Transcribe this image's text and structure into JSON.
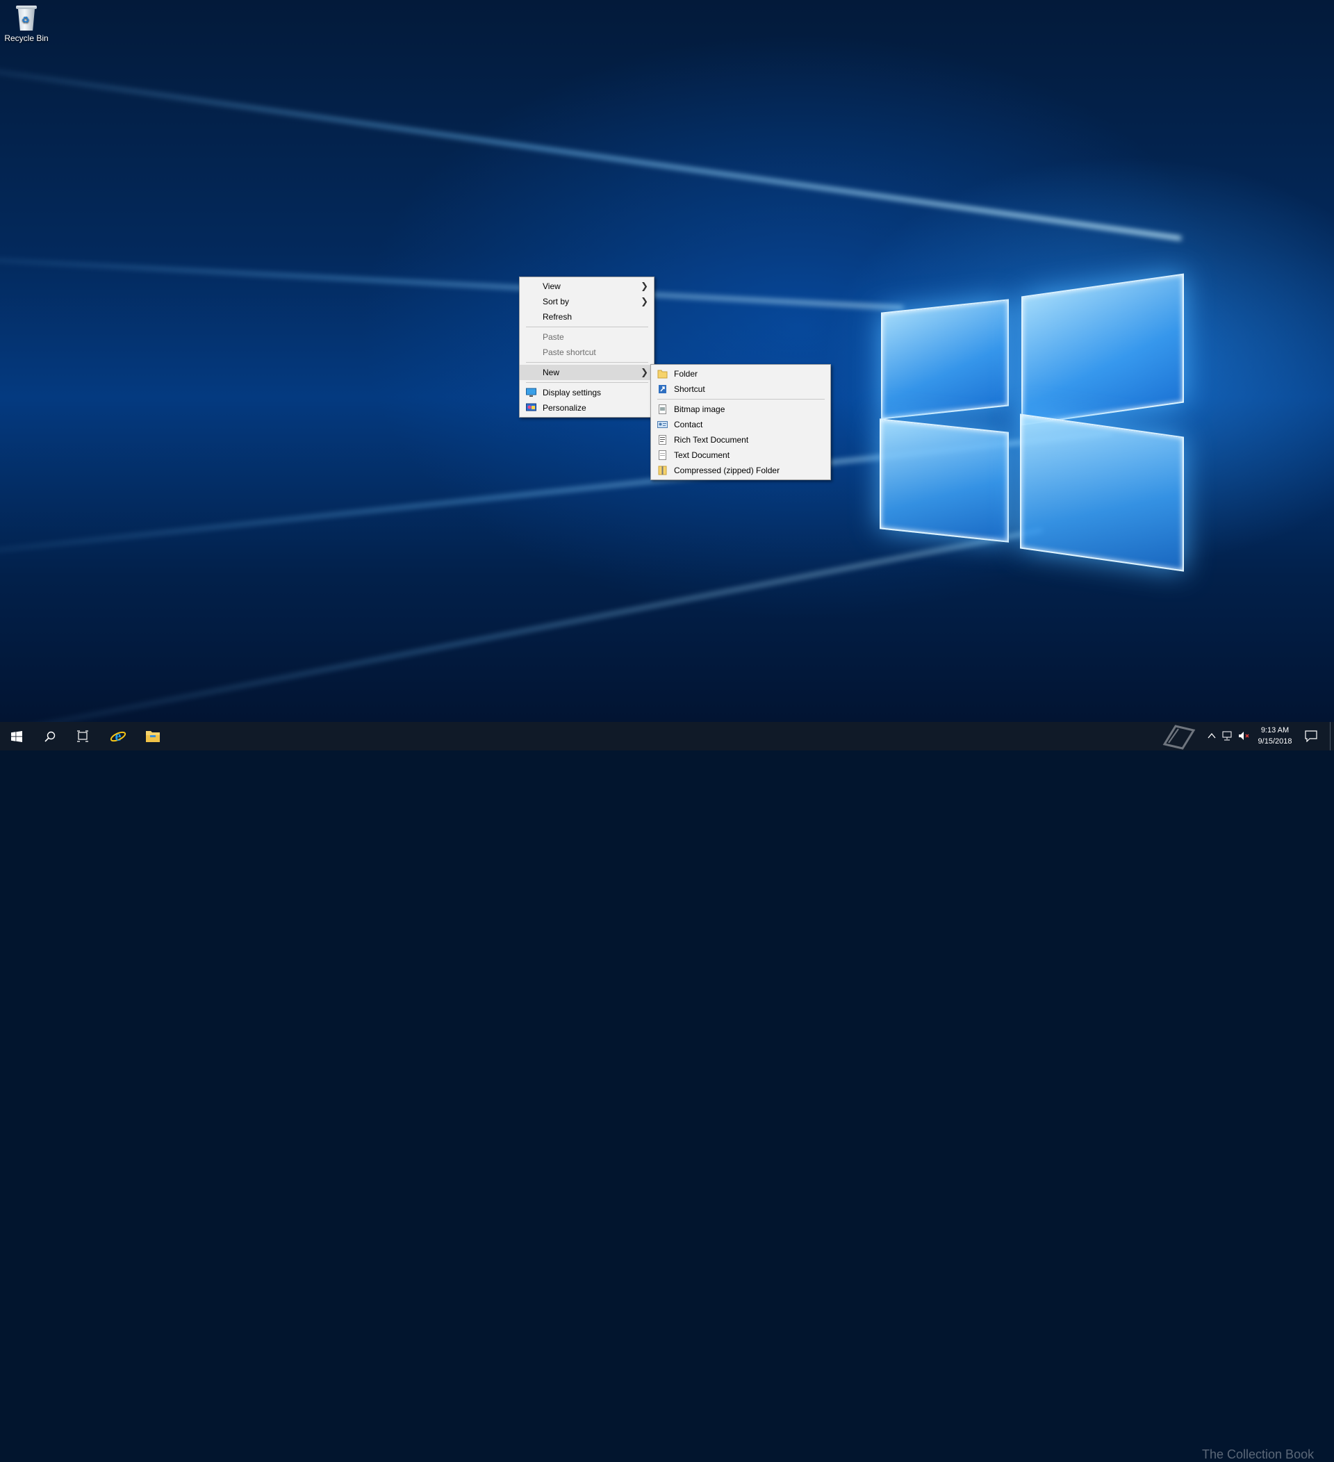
{
  "desktop": {
    "icons": [
      {
        "label": "Recycle Bin",
        "icon": "recycle-bin-icon"
      }
    ]
  },
  "context_menu": {
    "view": "View",
    "sort_by": "Sort by",
    "refresh": "Refresh",
    "paste": "Paste",
    "paste_shortcut": "Paste shortcut",
    "new": "New",
    "display_settings": "Display settings",
    "personalize": "Personalize"
  },
  "new_submenu": {
    "folder": "Folder",
    "shortcut": "Shortcut",
    "bitmap_image": "Bitmap image",
    "contact": "Contact",
    "rich_text_document": "Rich Text Document",
    "text_document": "Text Document",
    "compressed_folder": "Compressed (zipped) Folder"
  },
  "taskbar": {
    "icons": [
      "windows-start-icon",
      "search-icon",
      "task-view-icon",
      "internet-explorer-icon",
      "file-explorer-icon"
    ],
    "clock_time": "9:13 AM",
    "clock_date": "9/15/2018",
    "watermark": "The Collection Book"
  },
  "colors": {
    "taskbar": "#101a28",
    "menu_background": "#f2f2f2",
    "menu_highlight": "#dadada",
    "disabled_text": "#6d6d6d"
  }
}
